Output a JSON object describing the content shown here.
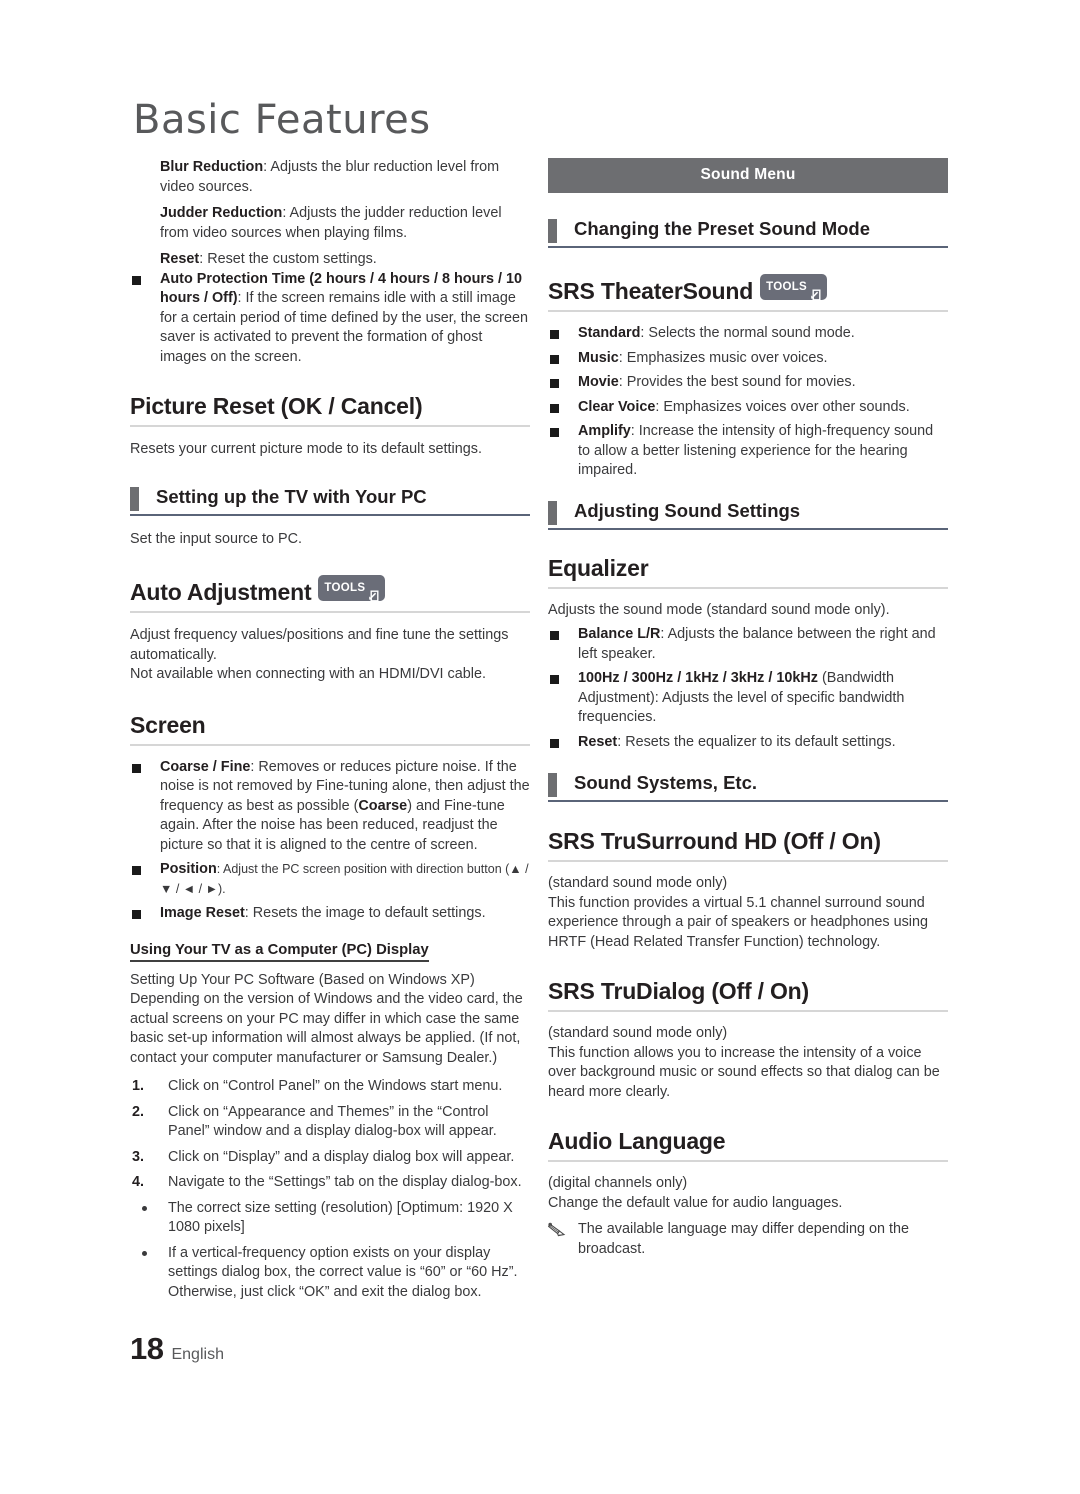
{
  "page": {
    "chapter_title": "Basic Features",
    "footer_page_number": "18",
    "footer_language": "English"
  },
  "colors": {
    "banner_bg": "#6d6e71",
    "section_tab": "#6d6e71",
    "section_rule": "#5a6478",
    "main_rule": "#d6d6d6",
    "tools_badge_bg": "#6a6d78",
    "body_text": "#3a3a3c",
    "heading_text": "#231f20",
    "title_text": "#58595b"
  },
  "left_column": {
    "picture_options": {
      "blur_reduction_label": "Blur Reduction",
      "blur_reduction_text": ": Adjusts the blur reduction level from video sources.",
      "judder_reduction_label": "Judder Reduction",
      "judder_reduction_text": ": Adjusts the judder reduction level from video sources when playing films.",
      "reset_label": "Reset",
      "reset_text": ": Reset the custom settings.",
      "auto_protection_label": "Auto Protection Time (2 hours / 4 hours / 8 hours / 10 hours / Off)",
      "auto_protection_text": ":  If the screen remains idle with a still image for a certain period of time defined by the user, the screen saver is activated to prevent the formation of ghost images on the screen."
    },
    "picture_reset": {
      "heading": "Picture Reset (OK / Cancel)",
      "body": "Resets your current picture mode to its default settings."
    },
    "setting_up_tv": {
      "heading": "Setting up the TV with Your PC",
      "body": "Set the input source to PC."
    },
    "auto_adjustment": {
      "heading": "Auto Adjustment",
      "tools_badge": "TOOLS",
      "body_line1": "Adjust frequency values/positions and fine tune the settings automatically.",
      "body_line2": "Not available when connecting with an HDMI/DVI cable."
    },
    "screen": {
      "heading": "Screen",
      "items": [
        {
          "label": "Coarse / Fine",
          "text": ": Removes or reduces picture noise. If the noise is not removed by Fine-tuning alone, then adjust the frequency as best as possible (",
          "inline_bold": "Coarse",
          "text_after": ") and Fine-tune again. After the noise has been reduced, readjust the picture so that it is aligned to the centre of screen."
        },
        {
          "label": "Position",
          "text": ": Adjust the PC screen position with direction button (▲ / ▼ / ◄ / ►)."
        },
        {
          "label": "Image Reset",
          "text": ": Resets the image to default settings."
        }
      ]
    },
    "pc_display": {
      "sub_heading": "Using Your TV as a Computer (PC) Display",
      "intro_line1": "Setting Up Your PC Software (Based on Windows XP)",
      "intro_line2": "Depending on the version of Windows and the video card, the actual screens on your PC may differ in which case the same basic set-up information will almost always be applied. (If not, contact your computer manufacturer or Samsung Dealer.)",
      "steps": [
        {
          "num": "1.",
          "text": "Click on “Control Panel” on the Windows start menu."
        },
        {
          "num": "2.",
          "text": "Click on “Appearance and Themes” in the “Control Panel” window and a display dialog-box will appear."
        },
        {
          "num": "3.",
          "text": "Click on “Display” and a display dialog box will appear."
        },
        {
          "num": "4.",
          "text": "Navigate to the “Settings” tab on the display dialog-box."
        }
      ],
      "bullets": [
        "The correct size setting (resolution) [Optimum: 1920 X 1080 pixels]",
        "If a vertical-frequency option exists on your display settings dialog box, the correct value is “60” or “60 Hz”. Otherwise, just click “OK” and exit the dialog box."
      ]
    }
  },
  "right_column": {
    "banner": "Sound Menu",
    "preset_sound_mode": {
      "heading": "Changing the Preset Sound Mode"
    },
    "srs_theatersound": {
      "heading": "SRS TheaterSound",
      "tools_badge": "TOOLS",
      "items": [
        {
          "label": "Standard",
          "text": ": Selects the normal sound mode."
        },
        {
          "label": "Music",
          "text": ": Emphasizes music over voices."
        },
        {
          "label": "Movie",
          "text": ": Provides the best sound for movies."
        },
        {
          "label": "Clear Voice",
          "text": ": Emphasizes voices over other sounds."
        },
        {
          "label": "Amplify",
          "text": ": Increase the intensity of high-frequency sound to allow a better listening experience for the hearing impaired."
        }
      ]
    },
    "adjusting_sound_settings": {
      "heading": "Adjusting Sound Settings"
    },
    "equalizer": {
      "heading": "Equalizer",
      "body": "Adjusts the sound mode (standard sound mode only).",
      "items": [
        {
          "label": "Balance L/R",
          "text": ": Adjusts the balance between the right and left speaker."
        },
        {
          "label": "100Hz / 300Hz / 1kHz / 3kHz / 10kHz",
          "text": " (Bandwidth Adjustment): Adjusts the level of specific bandwidth frequencies."
        },
        {
          "label": "Reset",
          "text": ": Resets the equalizer to its default settings."
        }
      ]
    },
    "sound_systems": {
      "heading": "Sound Systems, Etc."
    },
    "srs_trusurround": {
      "heading": "SRS TruSurround HD (Off / On)",
      "note": "(standard sound mode only)",
      "body": "This function provides a virtual 5.1 channel surround sound experience through a pair of speakers or headphones using HRTF (Head Related Transfer Function) technology."
    },
    "srs_trudialog": {
      "heading": "SRS TruDialog (Off / On)",
      "note": "(standard sound mode only)",
      "body": "This function allows you to increase the intensity of a voice over background music or sound effects so that dialog can be heard more clearly."
    },
    "audio_language": {
      "heading": "Audio Language",
      "note": "(digital channels only)",
      "body": "Change the default value for audio languages.",
      "tip": "The available language may differ depending on the broadcast."
    }
  }
}
